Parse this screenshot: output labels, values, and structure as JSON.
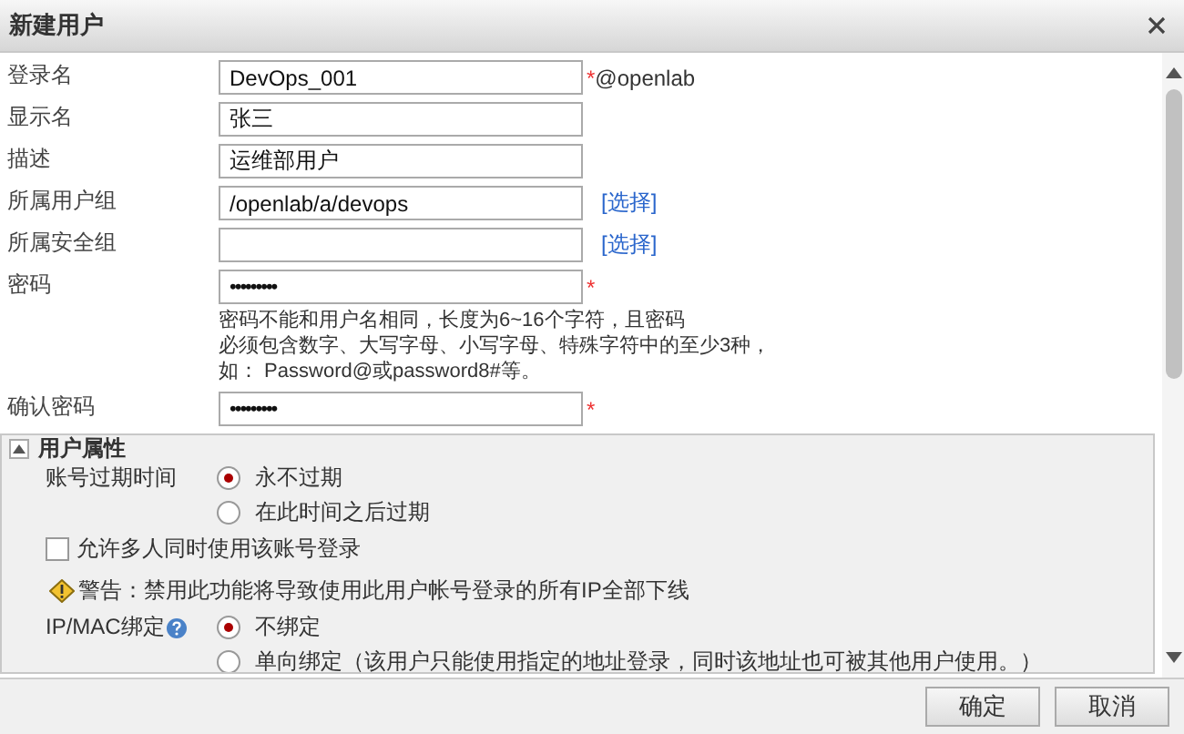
{
  "dialog": {
    "title": "新建用户"
  },
  "fields": [
    {
      "label": "登录名",
      "kind": "text",
      "value": "DevOps_001",
      "marker": "*",
      "suffix": "@openlab"
    },
    {
      "label": "显示名",
      "kind": "text",
      "value": "张三"
    },
    {
      "label": "描述",
      "kind": "text",
      "value": "运维部用户"
    },
    {
      "label": "所属用户组",
      "kind": "text",
      "value": "/openlab/a/devops",
      "link": "[选择]"
    },
    {
      "label": "所属安全组",
      "kind": "text",
      "link": "[选择]"
    },
    {
      "label": "密码",
      "kind": "password",
      "value": "•••••••••",
      "marker": "*",
      "hint": [
        "密码不能和用户名相同，长度为6~16个字符，且密码",
        "必须包含数字、大写字母、小写字母、特殊字符中的至少3种，",
        "如：  Password@或password8#等。"
      ]
    },
    {
      "label": "确认密码",
      "kind": "password",
      "value": "•••••••••",
      "marker": "*"
    }
  ],
  "user_properties": {
    "title": "用户属性",
    "expanded": true,
    "expiry": {
      "label": "账号过期时间",
      "options": [
        {
          "label": "永不过期",
          "selected": true
        },
        {
          "label": "在此时间之后过期",
          "selected": false
        }
      ]
    },
    "multi_login": {
      "label": "允许多人同时使用该账号登录",
      "checked": false
    },
    "warning": "警告：禁用此功能将导致使用此用户帐号登录的所有IP全部下线",
    "binding": {
      "label": "IP/MAC绑定",
      "options": [
        {
          "label": "不绑定",
          "selected": true
        },
        {
          "label": "单向绑定（该用户只能使用指定的地址登录，同时该地址也可被其他用户使用。）",
          "selected": false
        }
      ]
    }
  },
  "buttons": [
    "确定",
    "取消"
  ]
}
